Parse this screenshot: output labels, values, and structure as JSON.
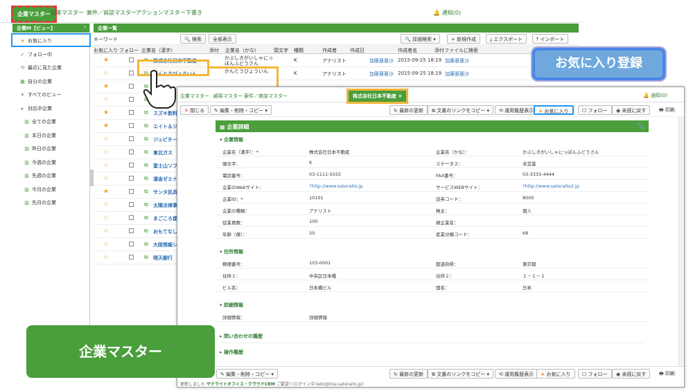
{
  "nav": {
    "tabs": [
      "企業マスター",
      "顧客マスター",
      "案件／商談マスター",
      "アクションマスター",
      "下書き"
    ],
    "notify": "通知(0)"
  },
  "sidebar": {
    "head": "企業M【ビュー】",
    "items": [
      {
        "label": "お気に入り",
        "icon": "star-icon",
        "type": "fav"
      },
      {
        "label": "フォロー中",
        "icon": "check-icon"
      },
      {
        "label": "最近に見た企業",
        "icon": "history-icon"
      },
      {
        "label": "自分の企業",
        "icon": "grid-icon"
      },
      {
        "label": "すべてのビュー",
        "icon": "chevron-down-icon",
        "type": "group"
      },
      {
        "label": "対応中企業",
        "icon": "chevron-right-icon",
        "type": "group"
      },
      {
        "label": "全ての企業",
        "icon": "building-icon",
        "type": "sub"
      },
      {
        "label": "本日の企業",
        "icon": "building-icon",
        "type": "sub"
      },
      {
        "label": "昨日の企業",
        "icon": "building-icon",
        "type": "sub"
      },
      {
        "label": "今週の企業",
        "icon": "building-icon",
        "type": "sub"
      },
      {
        "label": "先週の企業",
        "icon": "building-icon",
        "type": "sub"
      },
      {
        "label": "今月の企業",
        "icon": "building-icon",
        "type": "sub"
      },
      {
        "label": "先月の企業",
        "icon": "building-icon",
        "type": "sub"
      }
    ]
  },
  "list": {
    "title": "企業一覧",
    "keyword": "キーワード",
    "buttons": {
      "search": "検索",
      "show_all": "全部表示",
      "adv_search": "詳細検索",
      "new": "新規作成",
      "export": "エクスポート",
      "import": "インポート"
    },
    "columns": [
      "お気に入り",
      "フォロー",
      "企業名（漢字）",
      "添付",
      "企業名（かな）",
      "頭文字",
      "種類",
      "作成者",
      "作成日",
      "作成者名",
      "添付ファイルに検索"
    ],
    "rows": [
      {
        "star": "★",
        "name": "株式会社日本不動産",
        "kana": "かぶしきがいしゃにっぽんふどうさん",
        "initial": "K",
        "type": "アナリスト",
        "creator": "加藤亜亜沙",
        "date": "2015-09-25 18:19",
        "creator2": "加藤亜亜沙"
      },
      {
        "star": "☆",
        "name": "かんとうびょういん",
        "kana": "かんとうびょういん",
        "initial": "K",
        "type": "アナリスト",
        "creator": "加藤亜亜沙",
        "date": "2015-09-25 18:19",
        "creator2": "加藤亜亜沙"
      },
      {
        "star": "★",
        "name": "",
        "kana": "",
        "initial": "",
        "type": "",
        "creator": "",
        "date": "",
        "creator2": ""
      },
      {
        "star": "☆",
        "name": "",
        "kana": "",
        "initial": "",
        "type": "",
        "creator": "",
        "date": "",
        "creator2": ""
      },
      {
        "star": "★",
        "name": "スズキ飲料",
        "kana": "",
        "initial": "",
        "type": "",
        "creator": "",
        "date": "",
        "creator2": ""
      },
      {
        "star": "★",
        "name": "エイト＆ジ",
        "kana": "",
        "initial": "",
        "type": "",
        "creator": "",
        "date": "",
        "creator2": ""
      },
      {
        "star": "☆",
        "name": "ジュピター",
        "kana": "",
        "initial": "",
        "type": "",
        "creator": "",
        "date": "",
        "creator2": ""
      },
      {
        "star": "☆",
        "name": "東北ガス",
        "kana": "",
        "initial": "",
        "type": "",
        "creator": "",
        "date": "",
        "creator2": ""
      },
      {
        "star": "☆",
        "name": "富士山ソフ",
        "kana": "",
        "initial": "",
        "type": "",
        "creator": "",
        "date": "",
        "creator2": ""
      },
      {
        "star": "☆",
        "name": "凛宙ゼミナ",
        "kana": "",
        "initial": "",
        "type": "",
        "creator": "",
        "date": "",
        "creator2": ""
      },
      {
        "star": "★",
        "name": "サンタ民具",
        "kana": "",
        "initial": "",
        "type": "",
        "creator": "",
        "date": "",
        "creator2": ""
      },
      {
        "star": "☆",
        "name": "太陽法律事",
        "kana": "",
        "initial": "",
        "type": "",
        "creator": "",
        "date": "",
        "creator2": ""
      },
      {
        "star": "☆",
        "name": "まごころ建",
        "kana": "",
        "initial": "",
        "type": "",
        "creator": "",
        "date": "",
        "creator2": ""
      },
      {
        "star": "☆",
        "name": "おもてなし",
        "kana": "",
        "initial": "",
        "type": "",
        "creator": "",
        "date": "",
        "creator2": ""
      },
      {
        "star": "☆",
        "name": "大阪情報シ",
        "kana": "",
        "initial": "",
        "type": "",
        "creator": "",
        "date": "",
        "creator2": ""
      },
      {
        "star": "☆",
        "name": "晴天銀行",
        "kana": "",
        "initial": "",
        "type": "",
        "creator": "",
        "date": "",
        "creator2": ""
      }
    ]
  },
  "banners": {
    "fav": "お気に入り登録",
    "master": "企業マスター"
  },
  "overlay": {
    "nav": {
      "tabs": [
        "企業マスター",
        "顧客マスター",
        "案件／商談マスター"
      ],
      "active": "株式会社日本不動産",
      "close": "×",
      "notify": "通知(0)"
    },
    "toolbar": {
      "close": "閉じる",
      "edit": "編集・削除・コピー",
      "refresh": "最新の更新",
      "copy_link": "文書のリンクをコピー",
      "history": "運用履歴表示",
      "fav": "お気に入り",
      "follow": "フォロー",
      "back": "未読に戻す",
      "print": "印刷"
    },
    "panel_title": "企業詳細",
    "sections": {
      "basic": "企業情報",
      "address": "住所情報",
      "detail": "詳細情報",
      "inquiry": "問い合わせの履歴",
      "ops": "操作履歴"
    },
    "fields": [
      [
        "企業名（漢字）：*",
        "株式会社日本不動産",
        "企業名（かな）：",
        "かぶしきがいしゃにっぽんふどうさん"
      ],
      [
        "頭文字：",
        "K",
        "ステータス：",
        "未営業"
      ],
      [
        "電話番号：",
        "03-1111-5555",
        "FAX番号：",
        "03-3333-4444"
      ],
      [
        "企業のWebサイト：",
        "?http://www.sateraito.jp",
        "サービスWEBサイト：",
        "?http://www.sateraito2.jp"
      ],
      [
        "企業ID：*",
        "10101",
        "証券コード：",
        "8000"
      ],
      [
        "企業の種類：",
        "アナリスト",
        "株主：",
        "個人"
      ],
      [
        "従業員数：",
        "100",
        "親企業名：",
        ""
      ],
      [
        "年齢（億）：",
        "50",
        "産業分類コード：",
        "68"
      ]
    ],
    "address": [
      [
        "郵便番号：",
        "103-0001",
        "都道府県：",
        "東京都"
      ],
      [
        "住所１：",
        "中央区日本橋",
        "住所２：",
        "１－１－１"
      ],
      [
        "ビル名：",
        "日本橋ビル",
        "国名：",
        "日本"
      ]
    ],
    "detail": [
      [
        "詳細情報：",
        "詳細情報"
      ]
    ],
    "status": {
      "update": "更新しました",
      "app": "サテライトオフィス・クラウドCRM",
      "sent": "ご要望?",
      "login": "(ログイン中:keto@line.sateraito.jp)"
    }
  }
}
